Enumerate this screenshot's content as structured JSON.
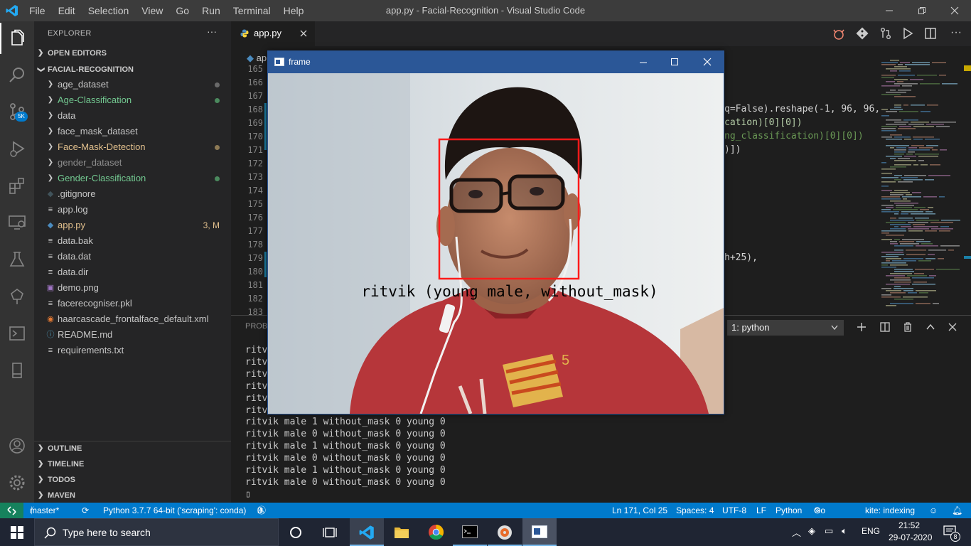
{
  "titlebar": {
    "title": "app.py - Facial-Recognition - Visual Studio Code",
    "menu": [
      "File",
      "Edit",
      "Selection",
      "View",
      "Go",
      "Run",
      "Terminal",
      "Help"
    ]
  },
  "activity_bar": {
    "icons": [
      "explorer-icon",
      "search-icon",
      "source-control-icon",
      "run-debug-icon",
      "extensions-icon",
      "remote-explorer-icon",
      "testing-icon",
      "tree-icon",
      "terminal-icon",
      "device-icon",
      "account-icon",
      "settings-gear-icon"
    ],
    "scm_badge": "5K"
  },
  "sidebar": {
    "header": "EXPLORER",
    "more": "···",
    "open_editors": "OPEN EDITORS",
    "project": "FACIAL-RECOGNITION",
    "items": [
      {
        "label": "age_dataset",
        "kind": "folder",
        "color": "#c5c5c5",
        "dot": "#6a6a6a"
      },
      {
        "label": "Age-Classification",
        "kind": "folder",
        "color": "#73c991",
        "dot": "#4b8a5e"
      },
      {
        "label": "data",
        "kind": "folder",
        "color": "#c5c5c5",
        "dot": ""
      },
      {
        "label": "face_mask_dataset",
        "kind": "folder",
        "color": "#c5c5c5",
        "dot": ""
      },
      {
        "label": "Face-Mask-Detection",
        "kind": "folder",
        "color": "#e2c08d",
        "dot": "#8d7a55"
      },
      {
        "label": "gender_dataset",
        "kind": "folder",
        "color": "#8c8c8c",
        "dot": ""
      },
      {
        "label": "Gender-Classification",
        "kind": "folder",
        "color": "#73c991",
        "dot": "#4b8a5e"
      },
      {
        "label": ".gitignore",
        "kind": "gitignore",
        "color": "#c5c5c5",
        "dot": ""
      },
      {
        "label": "app.log",
        "kind": "lines",
        "color": "#c5c5c5",
        "dot": ""
      },
      {
        "label": "app.py",
        "kind": "python",
        "color": "#e2c08d",
        "dot": "",
        "badge": "3, M"
      },
      {
        "label": "data.bak",
        "kind": "lines",
        "color": "#c5c5c5",
        "dot": ""
      },
      {
        "label": "data.dat",
        "kind": "lines",
        "color": "#c5c5c5",
        "dot": ""
      },
      {
        "label": "data.dir",
        "kind": "lines",
        "color": "#c5c5c5",
        "dot": ""
      },
      {
        "label": "demo.png",
        "kind": "image",
        "color": "#c5c5c5",
        "dot": ""
      },
      {
        "label": "facerecogniser.pkl",
        "kind": "lines",
        "color": "#c5c5c5",
        "dot": ""
      },
      {
        "label": "haarcascade_frontalface_default.xml",
        "kind": "rss",
        "color": "#c5c5c5",
        "dot": ""
      },
      {
        "label": "README.md",
        "kind": "info",
        "color": "#c5c5c5",
        "dot": ""
      },
      {
        "label": "requirements.txt",
        "kind": "lines",
        "color": "#c5c5c5",
        "dot": ""
      }
    ],
    "bottom_sections": [
      "OUTLINE",
      "TIMELINE",
      "TODOS",
      "MAVEN"
    ]
  },
  "editor": {
    "tab": "app.py",
    "breadcrumb": "app.py",
    "line_numbers": [
      "165",
      "166",
      "167",
      "168",
      "169",
      "170",
      "171",
      "172",
      "173",
      "174",
      "175",
      "176",
      "177",
      "178",
      "179",
      "180",
      "181",
      "182",
      "183"
    ],
    "visible_code": [
      {
        "line": "168",
        "text": "q=False).reshape(-1, 96, 96,"
      },
      {
        "line": "169",
        "text": "cation)[0][0])"
      },
      {
        "line": "170",
        "text": "ng_classification)[0][0])"
      },
      {
        "line": "171",
        "text": ")])"
      },
      {
        "line": "179",
        "text": "h+25),"
      }
    ]
  },
  "panel": {
    "tab": "PROBL",
    "terminal_select": "1: python",
    "hidden_lines": [
      "ritvi",
      "ritvi",
      "ritvi",
      "ritvi",
      "ritvi",
      "ritvi"
    ],
    "lines": [
      "ritvik male 1 without_mask 0 young 0",
      "ritvik male 0 without_mask 0 young 0",
      "ritvik male 1 without_mask 0 young 0",
      "ritvik male 0 without_mask 0 young 0",
      "ritvik male 1 without_mask 0 young 0",
      "ritvik male 0 without_mask 0 young 0"
    ],
    "prompt": "▯"
  },
  "frame_window": {
    "title": "frame",
    "label": "ritvik (young male, without_mask)"
  },
  "statusbar": {
    "branch": "master*",
    "python": "Python 3.7.7 64-bit ('scraping': conda)",
    "errors": "0",
    "warnings": "3",
    "position": "Ln 171, Col 25",
    "spaces": "Spaces: 4",
    "encoding": "UTF-8",
    "eol": "LF",
    "language": "Python",
    "golive": "Go Live",
    "kite": "kite: indexing"
  },
  "taskbar": {
    "search_placeholder": "Type here to search",
    "time": "21:52",
    "date": "29-07-2020",
    "lang": "ENG",
    "notif_count": "8"
  }
}
